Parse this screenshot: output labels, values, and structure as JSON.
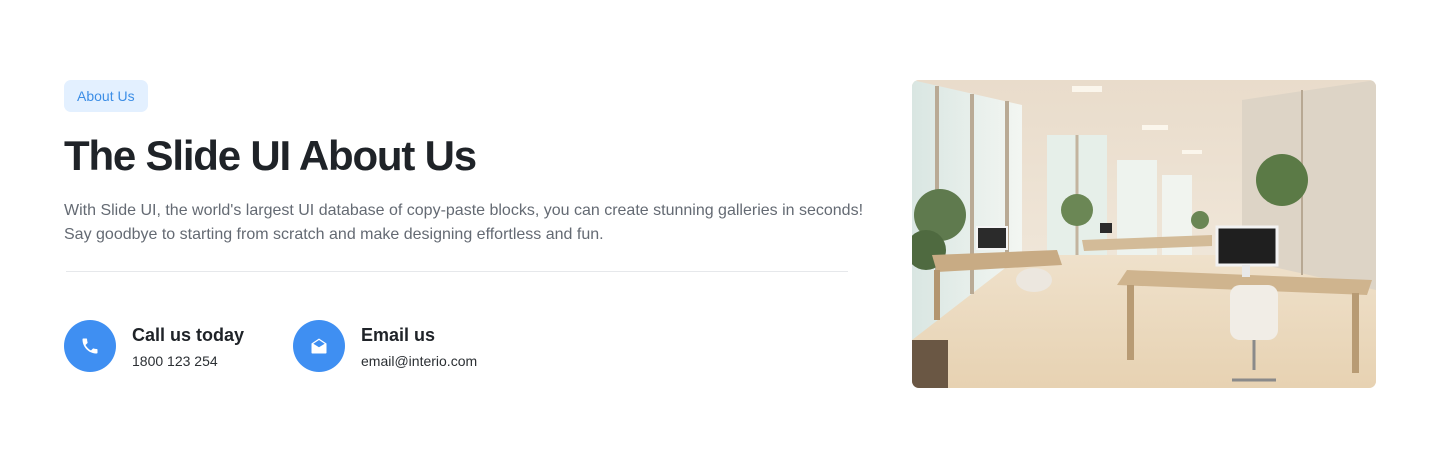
{
  "badge": {
    "label": "About Us"
  },
  "heading": {
    "title": "The Slide UI About Us"
  },
  "description": "With Slide UI, the world's largest UI database of copy-paste blocks, you can create stunning galleries in seconds! Say goodbye to starting from scratch and make designing effortless and fun.",
  "contacts": [
    {
      "title": "Call us today",
      "value": "1800 123 254",
      "icon": "phone-icon"
    },
    {
      "title": "Email us",
      "value": "email@interio.com",
      "icon": "envelope-open-icon"
    }
  ],
  "colors": {
    "accent": "#3f8ff2",
    "badge_bg": "#e3f0ff",
    "badge_text": "#3d8ee6",
    "heading": "#1f2328",
    "body_text": "#646a73"
  },
  "image": {
    "subject": "bright modern office interior"
  }
}
